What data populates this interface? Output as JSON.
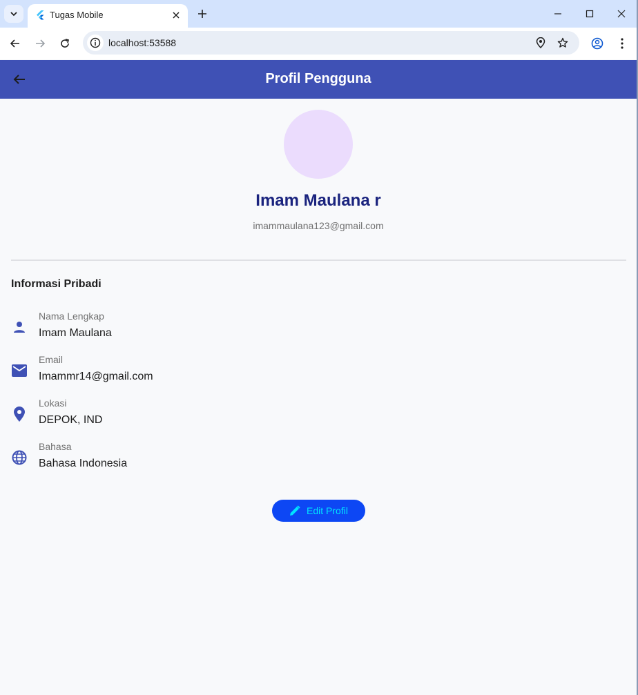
{
  "browser": {
    "tab_title": "Tugas Mobile",
    "url": "localhost:53588"
  },
  "appbar": {
    "title": "Profil Pengguna"
  },
  "profile": {
    "name": "Imam Maulana r",
    "email": "imammaulana123@gmail.com",
    "avatar_color": "#ebdcfd"
  },
  "section": {
    "title": "Informasi Pribadi"
  },
  "info": [
    {
      "icon": "person-icon",
      "label": "Nama Lengkap",
      "value": "Imam Maulana"
    },
    {
      "icon": "email-icon",
      "label": "Email",
      "value": "Imammr14@gmail.com"
    },
    {
      "icon": "location-icon",
      "label": "Lokasi",
      "value": "DEPOK, IND"
    },
    {
      "icon": "globe-icon",
      "label": "Bahasa",
      "value": "Bahasa Indonesia"
    }
  ],
  "edit_button": {
    "label": "Edit Profil"
  },
  "colors": {
    "primary": "#3f51b5",
    "name_text": "#1a237e",
    "button_bg": "#0d47f4",
    "button_text": "#00e5ff",
    "icon": "#3f51b5"
  }
}
